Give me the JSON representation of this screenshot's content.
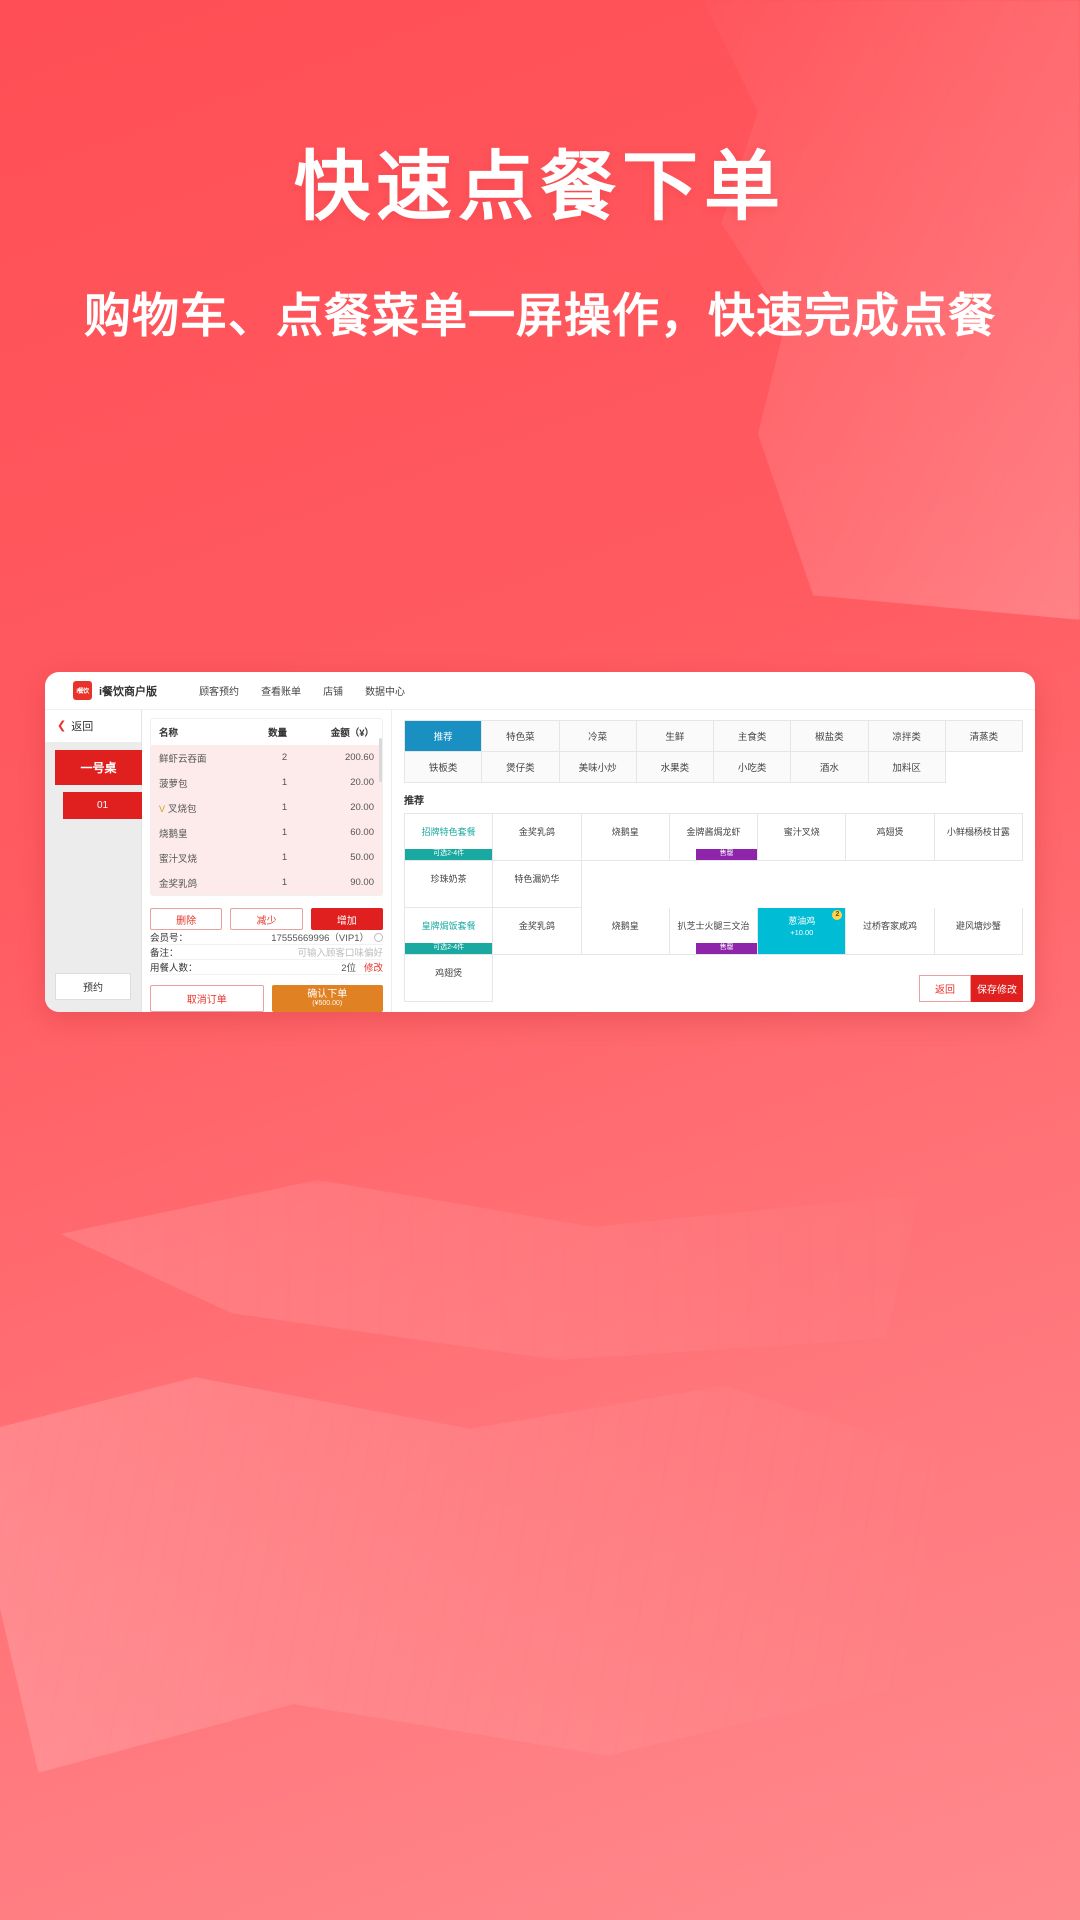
{
  "hero": {
    "title": "快速点餐下单",
    "subtitle": "购物车、点餐菜单一屏操作，快速完成点餐"
  },
  "colors": {
    "background": "#ff5a5f",
    "brand_red": "#e01f1f",
    "accent_blue": "#1a8fc1",
    "accent_teal": "#1aa9a0",
    "accent_orange": "#e08124",
    "highlight_cyan": "#00bcd4",
    "sold_out_purple": "#8e24aa"
  },
  "app": {
    "brand": {
      "logo_text": "i餐饮",
      "name": "i餐饮商户版"
    },
    "nav": [
      {
        "label": "顾客预约"
      },
      {
        "label": "查看账单"
      },
      {
        "label": "店铺"
      },
      {
        "label": "数据中心"
      }
    ],
    "sidebar": {
      "back_label": "返回",
      "back_icon": "chevron-left-icon",
      "table_label": "一号桌",
      "table_number": "01",
      "reserve_label": "预约"
    },
    "order": {
      "columns": {
        "name": "名称",
        "qty": "数量",
        "amount": "金额（¥）"
      },
      "items": [
        {
          "name": "鲜虾云吞面",
          "qty": "2",
          "amount": "200.60",
          "vip": false
        },
        {
          "name": "菠萝包",
          "qty": "1",
          "amount": "20.00",
          "vip": false
        },
        {
          "name": "叉烧包",
          "qty": "1",
          "amount": "20.00",
          "vip": true,
          "vip_mark": "V"
        },
        {
          "name": "烧鹅皇",
          "qty": "1",
          "amount": "60.00",
          "vip": false
        },
        {
          "name": "蜜汁叉烧",
          "qty": "1",
          "amount": "50.00",
          "vip": false
        },
        {
          "name": "金奖乳鸽",
          "qty": "1",
          "amount": "90.00",
          "vip": false
        }
      ],
      "qty_actions": [
        {
          "label": "删除",
          "style": "outline"
        },
        {
          "label": "减少",
          "style": "outline"
        },
        {
          "label": "增加",
          "style": "primary"
        }
      ],
      "fields": [
        {
          "label": "会员号：",
          "value": "17555669996（VIP1）",
          "icon": "eye-icon"
        },
        {
          "label": "备注：",
          "placeholder": "可输入顾客口味偏好"
        },
        {
          "label": "用餐人数：",
          "value": "2位",
          "link": "修改"
        }
      ],
      "cancel_label": "取消订单",
      "confirm_label": "确认下单",
      "confirm_sub": "(¥500.00)"
    },
    "menu": {
      "categories": [
        {
          "label": "推荐",
          "active": true
        },
        {
          "label": "特色菜",
          "active": false
        },
        {
          "label": "冷菜",
          "active": false
        },
        {
          "label": "生鲜",
          "active": false
        },
        {
          "label": "主食类",
          "active": false
        },
        {
          "label": "椒盐类",
          "active": false
        },
        {
          "label": "凉拌类",
          "active": false
        },
        {
          "label": "清蒸类",
          "active": false
        },
        {
          "label": "铁板类",
          "active": false
        },
        {
          "label": "煲仔类",
          "active": false
        },
        {
          "label": "美味小炒",
          "active": false
        },
        {
          "label": "水果类",
          "active": false
        },
        {
          "label": "小吃类",
          "active": false
        },
        {
          "label": "酒水",
          "active": false
        },
        {
          "label": "加料区",
          "active": false
        }
      ],
      "section_title": "推荐",
      "dishes": [
        {
          "name": "招牌特色套餐",
          "style": "combo",
          "tag": "可选2-4件",
          "tag_style": "teal"
        },
        {
          "name": "金奖乳鸽",
          "style": "normal"
        },
        {
          "name": "烧鹅皇",
          "style": "normal"
        },
        {
          "name": "金牌酱焗龙虾",
          "style": "normal",
          "tag": "售罄",
          "tag_style": "purple"
        },
        {
          "name": "蜜汁叉烧",
          "style": "normal"
        },
        {
          "name": "鸡翅煲",
          "style": "normal"
        },
        {
          "name": "小鲜榻杨枝甘露",
          "style": "normal"
        },
        {
          "name": "珍珠奶茶",
          "style": "normal"
        },
        {
          "name": "特色漏奶华",
          "style": "normal"
        },
        {
          "name": "",
          "style": "empty"
        },
        {
          "name": "",
          "style": "empty"
        },
        {
          "name": "",
          "style": "empty"
        },
        {
          "name": "",
          "style": "empty"
        },
        {
          "name": "",
          "style": "empty"
        },
        {
          "name": "皇牌焗饭套餐",
          "style": "combo",
          "tag": "可选2-4件",
          "tag_style": "teal"
        },
        {
          "name": "金奖乳鸽",
          "style": "normal"
        },
        {
          "name": "烧鹅皇",
          "style": "normal"
        },
        {
          "name": "扒芝士火腿三文治",
          "style": "normal",
          "tag": "售罄",
          "tag_style": "purple"
        },
        {
          "name": "葱油鸡",
          "style": "highlight",
          "badge": "2",
          "price_add": "+10.00"
        },
        {
          "name": "过桥客家咸鸡",
          "style": "normal"
        },
        {
          "name": "避风塘炒蟹",
          "style": "normal"
        },
        {
          "name": "鸡翅煲",
          "style": "normal"
        }
      ],
      "footer": {
        "back_label": "返回",
        "save_label": "保存修改"
      }
    }
  }
}
